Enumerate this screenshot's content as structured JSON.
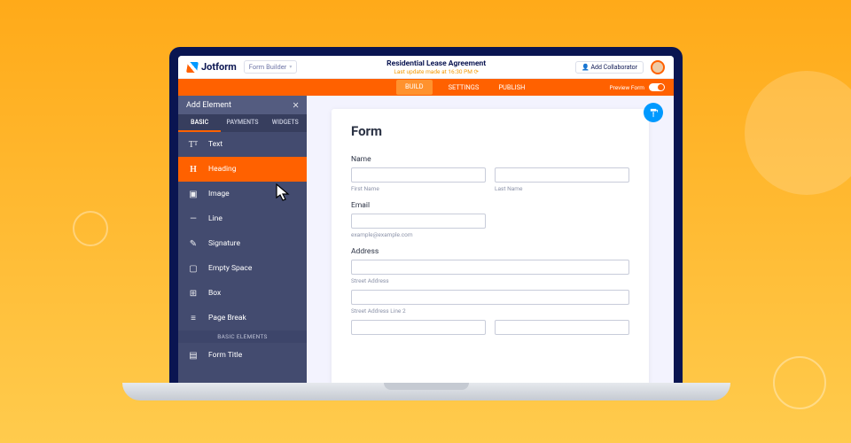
{
  "header": {
    "logo_text": "Jotform",
    "form_builder_label": "Form Builder",
    "title": "Residential Lease Agreement",
    "subtitle": "Last update made at 16:30 PM ⟳",
    "add_collaborator": "Add Collaborator"
  },
  "nav": {
    "items": [
      "BUILD",
      "SETTINGS",
      "PUBLISH"
    ],
    "preview_label": "Preview Form"
  },
  "sidebar": {
    "title": "Add Element",
    "tabs": [
      "BASIC",
      "PAYMENTS",
      "WIDGETS"
    ],
    "elements": [
      {
        "icon": "TT",
        "label": "Text"
      },
      {
        "icon": "H",
        "label": "Heading"
      },
      {
        "icon": "▣",
        "label": "Image"
      },
      {
        "icon": "—",
        "label": "Line"
      },
      {
        "icon": "✎",
        "label": "Signature"
      },
      {
        "icon": "▢",
        "label": "Empty Space"
      },
      {
        "icon": "⊞",
        "label": "Box"
      },
      {
        "icon": "≡",
        "label": "Page Break"
      }
    ],
    "section_title": "BASIC ELEMENTS",
    "below": {
      "icon": "▤",
      "label": "Form Title"
    }
  },
  "form": {
    "title": "Form",
    "name_label": "Name",
    "first_name_sub": "First Name",
    "last_name_sub": "Last Name",
    "email_label": "Email",
    "email_sub": "example@example.com",
    "address_label": "Address",
    "street_sub": "Street Address",
    "street2_sub": "Street Address Line 2"
  }
}
